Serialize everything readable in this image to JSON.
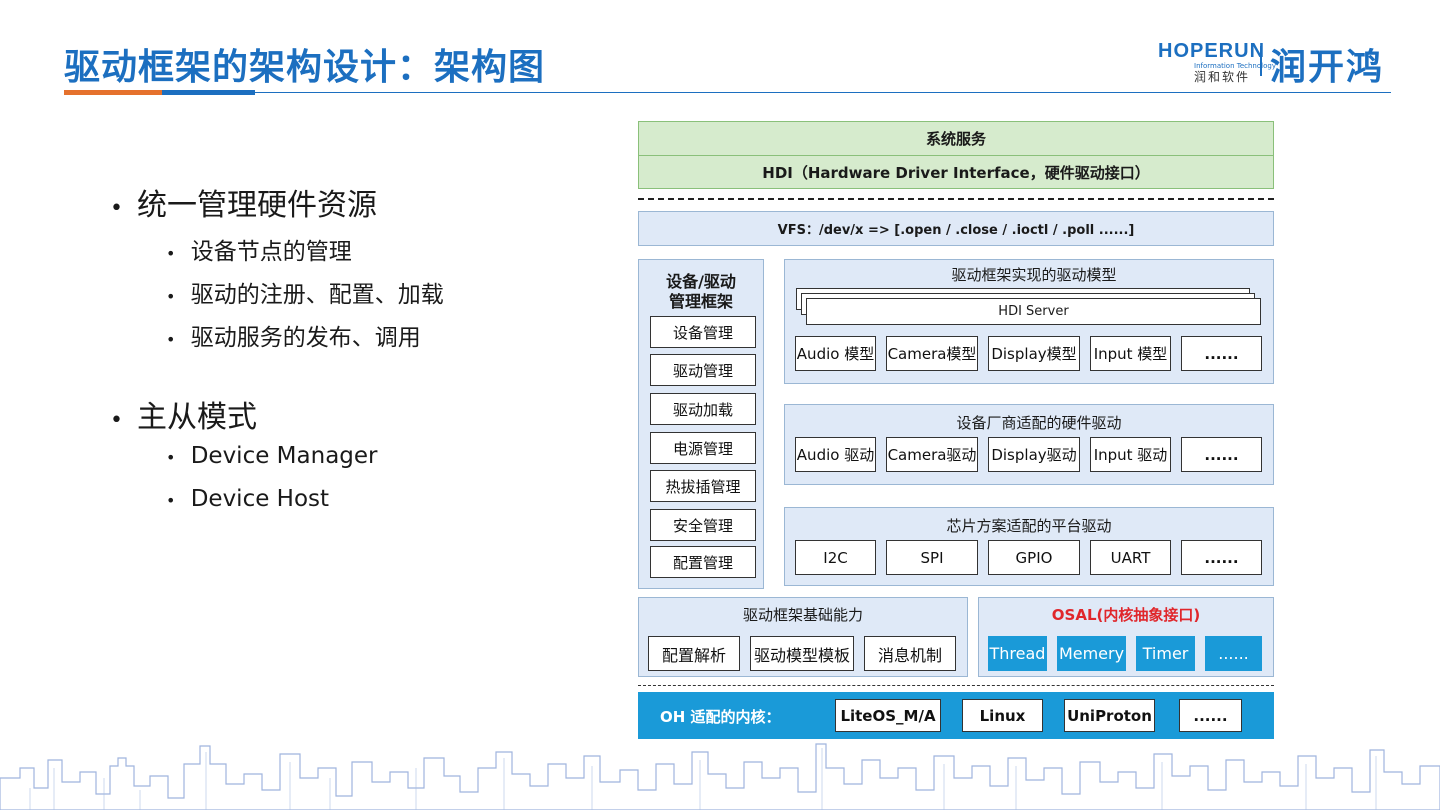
{
  "header": {
    "title": "驱动框架的架构设计：架构图",
    "logo_en": "HOPERUN",
    "logo_sub": "Information Technology",
    "logo_cn_small": "润和软件",
    "logo_cn": "润开鸿"
  },
  "bullets": [
    {
      "text": "统一管理硬件资源",
      "children": [
        "设备节点的管理",
        "驱动的注册、配置、加载",
        "驱动服务的发布、调用"
      ]
    },
    {
      "text": "主从模式",
      "children": [
        "Device Manager",
        "Device Host"
      ]
    }
  ],
  "diagram": {
    "system_service": "系统服务",
    "hdi": "HDI（Hardware Driver Interface，硬件驱动接口）",
    "vfs": "VFS：/dev/x  => [.open / .close / .ioctl / .poll ......]",
    "device_mgmt": {
      "title": "设备/驱动\n管理框架",
      "items": [
        "设备管理",
        "驱动管理",
        "驱动加载",
        "电源管理",
        "热拔插管理",
        "安全管理",
        "配置管理"
      ]
    },
    "driver_model": {
      "title": "驱动框架实现的驱动模型",
      "hdi_server": "HDI Server",
      "items": [
        "Audio 模型",
        "Camera模型",
        "Display模型",
        "Input 模型",
        "......"
      ]
    },
    "vendor_driver": {
      "title": "设备厂商适配的硬件驱动",
      "items": [
        "Audio 驱动",
        "Camera驱动",
        "Display驱动",
        "Input 驱动",
        "......"
      ]
    },
    "platform_driver": {
      "title": "芯片方案适配的平台驱动",
      "items": [
        "I2C",
        "SPI",
        "GPIO",
        "UART",
        "......"
      ]
    },
    "base_capability": {
      "title": "驱动框架基础能力",
      "items": [
        "配置解析",
        "驱动模型模板",
        "消息机制"
      ]
    },
    "osal": {
      "title": "OSAL(内核抽象接口)",
      "items": [
        "Thread",
        "Memery",
        "Timer",
        "......"
      ]
    },
    "kernel": {
      "title": "OH 适配的内核：",
      "items": [
        "LiteOS_M/A",
        "Linux",
        "UniProton",
        "......"
      ]
    }
  },
  "colors": {
    "primary_blue": "#1c6fc0",
    "accent_orange": "#e5712d",
    "osal_red": "#e0262b",
    "kernel_blue": "#1a9ad8",
    "layer_blue_bg": "#dfe9f7",
    "green_bg": "#d6ebcd"
  }
}
